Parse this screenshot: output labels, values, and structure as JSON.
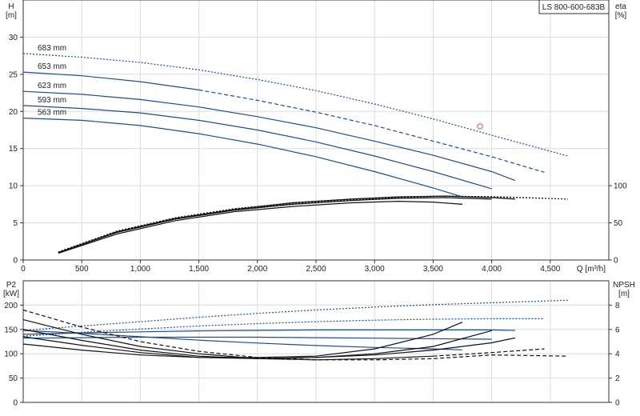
{
  "title": "LS 800-600-683B",
  "colors": {
    "blue": "#1f4e8c",
    "black": "#111111",
    "grid": "#dcdcdc",
    "marker": "#e05a5a"
  },
  "chart_data": [
    {
      "type": "line",
      "name": "head_efficiency",
      "y_left_label": [
        "H",
        "[m]"
      ],
      "y_right_label": [
        "eta",
        "[%]"
      ],
      "xlabel": "Q [m³/h]",
      "xlim": [
        0,
        5000
      ],
      "x_ticks": [
        0,
        500,
        1000,
        1500,
        2000,
        2500,
        3000,
        3500,
        4000,
        4500
      ],
      "x_tick_labels": [
        "0",
        "500",
        "1,000",
        "1,500",
        "2,000",
        "2,500",
        "3,000",
        "3,500",
        "4,000",
        "4,500"
      ],
      "ylim": [
        0,
        35
      ],
      "y_ticks": [
        0,
        5,
        10,
        15,
        20,
        25,
        30
      ],
      "eta_ticks": [
        0,
        50,
        100
      ],
      "eta_ylim": [
        0,
        350
      ],
      "grid": true,
      "series": [
        {
          "name": "683 mm",
          "color": "blue",
          "style": "dotted",
          "x": [
            0,
            500,
            1000,
            1500,
            2000,
            2500,
            3000,
            3500,
            4000,
            4650
          ],
          "y": [
            27.8,
            27.3,
            26.6,
            25.6,
            24.3,
            22.8,
            21.0,
            19.0,
            16.8,
            14.0
          ]
        },
        {
          "name": "653 mm",
          "color": "blue",
          "style": "mixed",
          "solid_until": 1500,
          "x": [
            0,
            500,
            1000,
            1500,
            2000,
            2500,
            3000,
            3500,
            4000,
            4450
          ],
          "y": [
            25.3,
            24.8,
            24.0,
            22.9,
            21.5,
            19.9,
            18.1,
            16.0,
            13.9,
            11.8
          ]
        },
        {
          "name": "623 mm",
          "color": "blue",
          "style": "solid",
          "x": [
            0,
            500,
            1000,
            1500,
            2000,
            2500,
            3000,
            3500,
            4000,
            4200
          ],
          "y": [
            22.7,
            22.3,
            21.6,
            20.6,
            19.3,
            17.8,
            16.0,
            14.1,
            11.9,
            10.7
          ]
        },
        {
          "name": "593 mm",
          "color": "blue",
          "style": "solid",
          "x": [
            0,
            500,
            1000,
            1500,
            2000,
            2500,
            3000,
            3500,
            4000
          ],
          "y": [
            20.8,
            20.4,
            19.8,
            18.8,
            17.5,
            15.9,
            14.0,
            11.9,
            9.6
          ]
        },
        {
          "name": "563 mm",
          "color": "blue",
          "style": "solid",
          "x": [
            0,
            500,
            1000,
            1500,
            2000,
            2500,
            3000,
            3500,
            3750
          ],
          "y": [
            19.1,
            18.8,
            18.1,
            17.0,
            15.6,
            13.9,
            11.9,
            9.7,
            8.5
          ]
        }
      ],
      "eta_series": [
        {
          "color": "black",
          "style": "dotted",
          "x": [
            300,
            800,
            1300,
            1800,
            2300,
            2800,
            3200,
            3600,
            4100,
            4650
          ],
          "eta": [
            10,
            38,
            56,
            68,
            76,
            81,
            84,
            86,
            85,
            82
          ]
        },
        {
          "color": "black",
          "style": "dotted",
          "x": [
            300,
            800,
            1300,
            1800,
            2300,
            2800,
            3200,
            3600,
            4000,
            4450
          ],
          "eta": [
            11,
            39,
            57,
            69,
            77,
            82,
            85,
            86,
            85,
            83
          ]
        },
        {
          "color": "black",
          "style": "solid",
          "x": [
            300,
            800,
            1300,
            1800,
            2300,
            2800,
            3200,
            3600,
            4000,
            4200
          ],
          "eta": [
            10,
            38,
            56,
            68,
            77,
            82,
            85,
            86,
            84,
            82
          ]
        },
        {
          "color": "black",
          "style": "solid",
          "x": [
            300,
            800,
            1300,
            1800,
            2300,
            2800,
            3200,
            3600,
            4000
          ],
          "eta": [
            10,
            37,
            55,
            67,
            75,
            80,
            83,
            84,
            82
          ]
        },
        {
          "color": "black",
          "style": "solid",
          "x": [
            300,
            800,
            1300,
            1800,
            2300,
            2800,
            3200,
            3500,
            3750
          ],
          "eta": [
            9,
            35,
            53,
            65,
            72,
            77,
            79,
            78,
            75
          ]
        }
      ],
      "marker": {
        "x": 3900,
        "y": 18.0
      }
    },
    {
      "type": "line",
      "name": "power_npsh",
      "y_left_label": [
        "P2",
        "[kW]"
      ],
      "y_right_label": [
        "NPSH",
        "[m]"
      ],
      "xlim": [
        0,
        5000
      ],
      "ylim": [
        0,
        250
      ],
      "y_ticks": [
        0,
        50,
        100,
        150,
        200
      ],
      "npsh_ticks": [
        0,
        2,
        4,
        6,
        8
      ],
      "npsh_ylim": [
        0,
        10
      ],
      "grid": true,
      "power_series": [
        {
          "color": "blue",
          "style": "dotted",
          "x": [
            0,
            500,
            1000,
            1500,
            2000,
            2500,
            3000,
            3500,
            4000,
            4650
          ],
          "y": [
            148,
            157,
            166,
            175,
            183,
            190,
            196,
            201,
            205,
            210
          ]
        },
        {
          "color": "blue",
          "style": "dotted",
          "x": [
            0,
            500,
            1000,
            1500,
            2000,
            2500,
            3000,
            3500,
            4000,
            4450
          ],
          "y": [
            136,
            144,
            151,
            157,
            162,
            166,
            169,
            171,
            172,
            172
          ]
        },
        {
          "color": "blue",
          "style": "solid",
          "x": [
            0,
            500,
            1000,
            1500,
            2000,
            2500,
            3000,
            3500,
            4000,
            4200
          ],
          "y": [
            140,
            143,
            145,
            147,
            148,
            149,
            149,
            149,
            149,
            148
          ]
        },
        {
          "color": "blue",
          "style": "solid",
          "x": [
            0,
            500,
            1000,
            1500,
            2000,
            2500,
            3000,
            3500,
            4000
          ],
          "y": [
            132,
            133,
            134,
            134,
            134,
            133,
            132,
            131,
            130
          ]
        },
        {
          "color": "blue",
          "style": "solid",
          "x": [
            0,
            500,
            1000,
            1500,
            2000,
            2500,
            3000,
            3500,
            3750
          ],
          "y": [
            148,
            142,
            135,
            128,
            122,
            117,
            113,
            110,
            108
          ]
        }
      ],
      "npsh_series": [
        {
          "color": "black",
          "style": "dashed",
          "x": [
            0,
            500,
            1000,
            1500,
            2000,
            2500,
            3000,
            3500,
            4000,
            4650
          ],
          "npsh": [
            7.6,
            6.2,
            5.0,
            4.2,
            3.7,
            3.5,
            3.5,
            3.6,
            3.9,
            3.8
          ]
        },
        {
          "color": "black",
          "style": "mixed",
          "solid_until": 3500,
          "x": [
            0,
            500,
            1000,
            1500,
            2000,
            2500,
            3000,
            3500,
            4000,
            4450
          ],
          "npsh": [
            6.8,
            5.6,
            4.6,
            4.0,
            3.6,
            3.5,
            3.6,
            3.8,
            4.1,
            4.4
          ]
        },
        {
          "color": "black",
          "style": "solid",
          "x": [
            0,
            500,
            1000,
            1500,
            2000,
            2500,
            3000,
            3500,
            4000,
            4200
          ],
          "npsh": [
            6.0,
            5.1,
            4.3,
            3.8,
            3.6,
            3.7,
            3.9,
            4.3,
            4.9,
            5.3
          ]
        },
        {
          "color": "black",
          "style": "solid",
          "x": [
            0,
            500,
            1000,
            1500,
            2000,
            2500,
            3000,
            3500,
            4000
          ],
          "npsh": [
            5.4,
            4.7,
            4.1,
            3.7,
            3.6,
            3.7,
            4.0,
            4.6,
            5.9
          ]
        },
        {
          "color": "black",
          "style": "solid",
          "x": [
            0,
            500,
            1000,
            1500,
            2000,
            2500,
            3000,
            3500,
            3750
          ],
          "npsh": [
            4.8,
            4.3,
            3.9,
            3.7,
            3.7,
            3.8,
            4.4,
            5.6,
            6.6
          ]
        }
      ]
    }
  ]
}
